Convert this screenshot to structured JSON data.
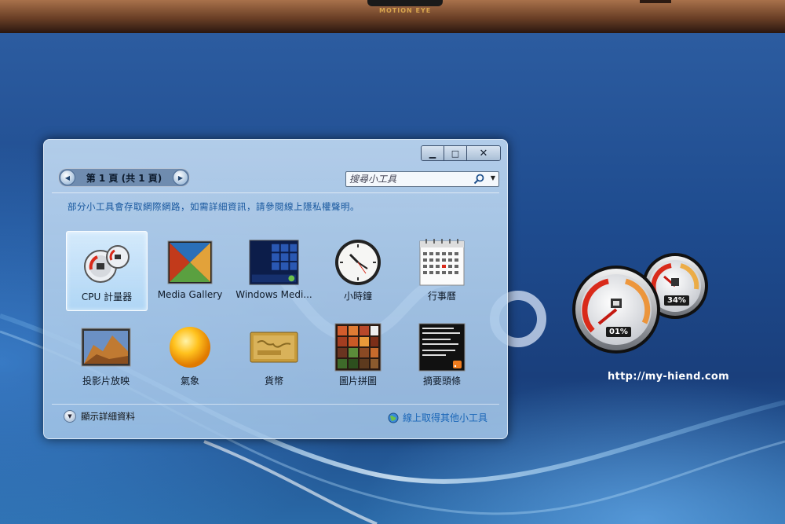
{
  "bezel": {
    "camera_label": "MOTION EYE"
  },
  "window": {
    "controls": {
      "minimize": "▁",
      "maximize": "□",
      "close": "✕"
    },
    "pager": {
      "text": "第 1 頁 (共 1 頁)"
    },
    "search": {
      "placeholder": "搜尋小工具"
    },
    "notice": "部分小工具會存取網際網路，如需詳細資訊，請參閱線上隱私權聲明。",
    "gadgets": [
      {
        "label": "CPU 計量器",
        "icon": "cpu-meter-icon",
        "selected": true
      },
      {
        "label": "Media Gallery",
        "icon": "media-gallery-icon",
        "selected": false
      },
      {
        "label": "Windows Medi...",
        "icon": "windows-media-icon",
        "selected": false
      },
      {
        "label": "小時鐘",
        "icon": "clock-icon",
        "selected": false
      },
      {
        "label": "行事曆",
        "icon": "calendar-icon",
        "selected": false
      },
      {
        "label": "投影片放映",
        "icon": "slideshow-icon",
        "selected": false
      },
      {
        "label": "氣象",
        "icon": "weather-icon",
        "selected": false
      },
      {
        "label": "貨幣",
        "icon": "currency-icon",
        "selected": false
      },
      {
        "label": "圖片拼圖",
        "icon": "picture-puzzle-icon",
        "selected": false
      },
      {
        "label": "摘要頭條",
        "icon": "feed-headlines-icon",
        "selected": false
      }
    ],
    "footer": {
      "details_label": "顯示詳細資料",
      "online_label": "線上取得其他小工具"
    }
  },
  "desktop_gadget": {
    "cpu_percent": "01%",
    "memory_percent": "34%"
  },
  "watermark": "http://my-hiend.com",
  "colors": {
    "notice_text": "#17579e",
    "online_link": "#1a66b8",
    "gauge_red": "#d92a1a"
  }
}
